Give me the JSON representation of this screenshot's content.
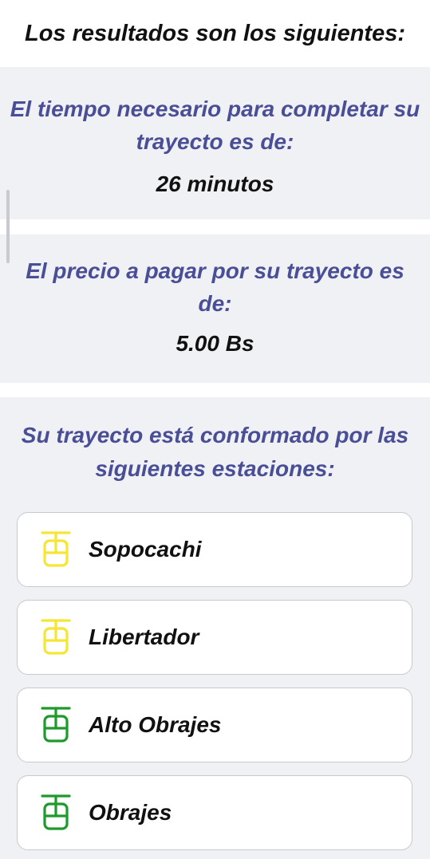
{
  "header": {
    "title": "Los resultados son los siguientes:"
  },
  "time": {
    "heading": "El tiempo necesario para completar su trayecto es de:",
    "value": "26 minutos"
  },
  "price": {
    "heading": "El precio a pagar por su trayecto es de:",
    "value": "5.00 Bs"
  },
  "stations": {
    "heading": "Su trayecto está conformado por las siguientes estaciones:",
    "items": [
      {
        "name": "Sopocachi",
        "icon": "cable-car-icon",
        "line_color": "#f5e633"
      },
      {
        "name": "Libertador",
        "icon": "cable-car-icon",
        "line_color": "#f5e633"
      },
      {
        "name": "Alto Obrajes",
        "icon": "cable-car-icon",
        "line_color": "#1e9a2c"
      },
      {
        "name": "Obrajes",
        "icon": "cable-car-icon",
        "line_color": "#1e9a2c"
      }
    ]
  }
}
